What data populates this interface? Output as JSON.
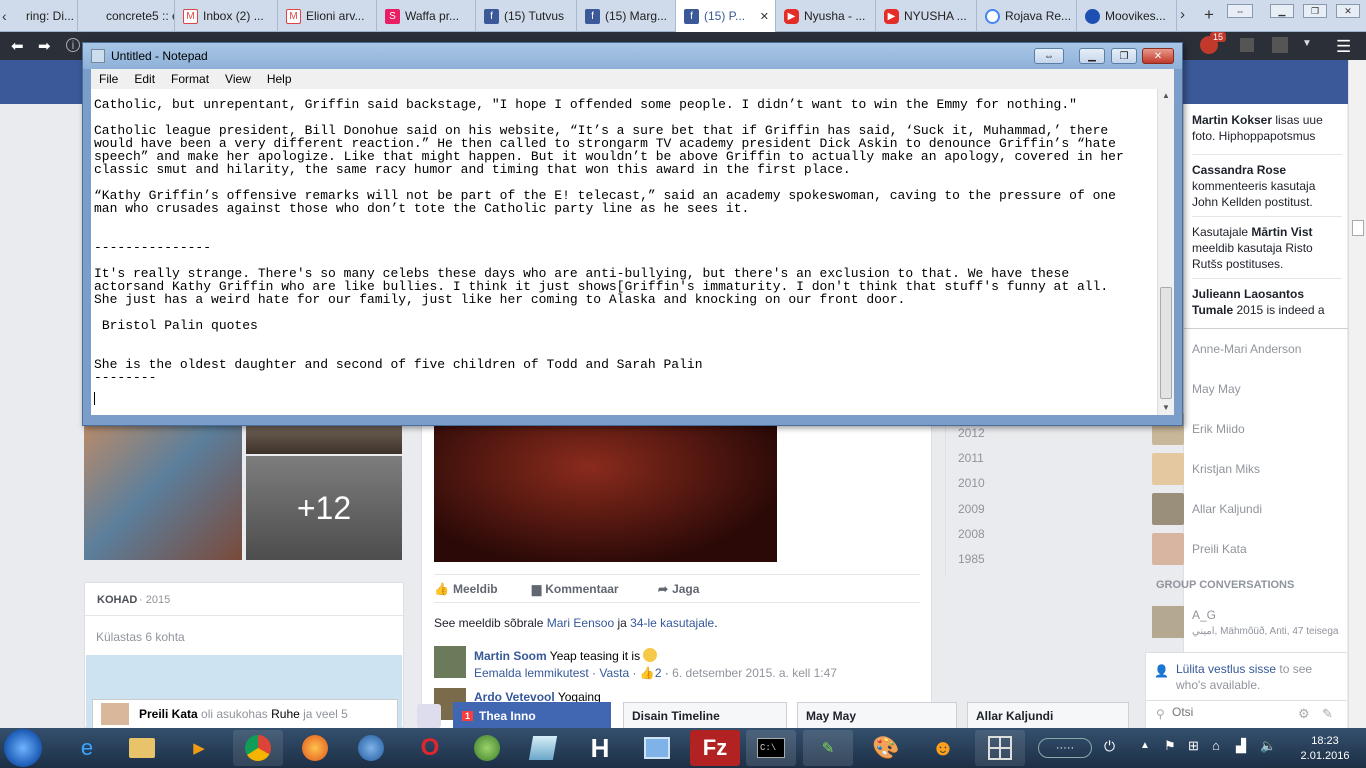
{
  "browser": {
    "tabs": [
      {
        "label": "ring: Di...",
        "icon": "page-icon"
      },
      {
        "label": "concrete5 :: e...",
        "icon": "page-icon"
      },
      {
        "label": "Inbox (2) ...",
        "icon": "gmail-icon"
      },
      {
        "label": "Elioni arv...",
        "icon": "gmail-icon"
      },
      {
        "label": "Waffa pr...",
        "icon": "waffa-icon"
      },
      {
        "label": "(15) Tutvus",
        "icon": "facebook-icon"
      },
      {
        "label": "(15) Marg...",
        "icon": "facebook-icon"
      },
      {
        "label": "(15) P...",
        "icon": "facebook-icon"
      },
      {
        "label": "Nyusha - ...",
        "icon": "youtube-icon"
      },
      {
        "label": "NYUSHA ...",
        "icon": "youtube-icon"
      },
      {
        "label": "Rojava Re...",
        "icon": "google-icon"
      },
      {
        "label": "Moovikes...",
        "icon": "moovikes-icon"
      }
    ],
    "ext_badge": "15"
  },
  "notepad": {
    "title": "Untitled - Notepad",
    "menu": [
      "File",
      "Edit",
      "Format",
      "View",
      "Help"
    ],
    "text": "Catholic, but unrepentant, Griffin said backstage, \"I hope I offended some people. I didn’t want to win the Emmy for nothing.\"\n\nCatholic league president, Bill Donohue said on his website, “It’s a sure bet that if Griffin has said, ‘Suck it, Muhammad,’ there\nwould have been a very different reaction.” He then called to strongarm TV academy president Dick Askin to denounce Griffin’s “hate\nspeech” and make her apologize. Like that might happen. But it wouldn’t be above Griffin to actually make an apology, covered in her\nclassic smut and hilarity, the same racy humor and timing that won this award in the first place.\n\n“Kathy Griffin’s offensive remarks will not be part of the E! telecast,” said an academy spokeswoman, caving to the pressure of one\nman who crusades against those who don’t tote the Catholic party line as he sees it.\n\n\n---------------\n\nIt's really strange. There's so many celebs these days who are anti-bullying, but there's an exclusion to that. We have these\nactorsand Kathy Griffin who are like bullies. I think it just shows[Griffin's immaturity. I don't think that stuff's funny at all.\nShe just has a weird hate for our family, just like her coming to Alaska and knocking on our front door.\n\n Bristol Palin quotes\n\n\nShe is the oldest daughter and second of five children of Todd and Sarah Palin\n--------\n"
  },
  "facebook": {
    "photo_more": "+12",
    "places_label": "KOHAD",
    "places_year": "· 2015",
    "places_visits": "Külastas 6 kohta",
    "place_post": {
      "name": "Preili Kata",
      "text": "oli asukohas",
      "place": "Ruhe",
      "more": "ja veel 5"
    },
    "actions": {
      "like": "Meeldib",
      "comment": "Kommentaar",
      "share": "Jaga"
    },
    "likes": {
      "pre": "See meeldib sõbrale",
      "friend": "Mari Eensoo",
      "mid": "ja",
      "count": "34-le kasutajale",
      "end": "."
    },
    "comment1": {
      "author": "Martin Soom",
      "text": "Yeap teasing it is",
      "remove": "Eemalda lemmikutest",
      "reply": "Vasta",
      "likes": "2",
      "time": "6. detsember 2015. a. kell 1:47"
    },
    "comment2": {
      "author": "Ardo Vetevool",
      "text": "Yogaing"
    },
    "years": [
      "2012",
      "2011",
      "2010",
      "2009",
      "2008",
      "1985"
    ],
    "ticker": [
      {
        "name": "Martin Kokser",
        "text": "lisas uue foto. Hiphoppapotsmus"
      },
      {
        "name": "Cassandra Rose",
        "text": "kommenteeris kasutaja John Kellden postitust."
      },
      {
        "name": "Mārtin Vist",
        "pre": "Kasutajale",
        "text": "meeldib kasutaja Risto Rutšs postituses."
      },
      {
        "name": "Julieann Laosantos Tumale",
        "text": "2015 is indeed a"
      }
    ],
    "friends": [
      "Anne-Mari Anderson",
      "May May",
      "Erik Miido",
      "Kristjan Miks",
      "Allar Kaljundi",
      "Preili Kata"
    ],
    "group_header": "GROUP CONVERSATIONS",
    "group": {
      "name": "A_G",
      "members": "اميني, Mähmõüð, Anti, 47 teisega"
    },
    "chat_off": {
      "link": "Lülita vestlus sisse",
      "text": "to see who's available."
    },
    "search_placeholder": "Otsi",
    "chat_tabs": [
      {
        "label": "Thea Inno",
        "badge": "1"
      },
      {
        "label": "Disain Timeline"
      },
      {
        "label": "May May"
      },
      {
        "label": "Allar Kaljundi"
      }
    ]
  },
  "taskbar": {
    "time": "18:23",
    "date": "2.01.2016"
  }
}
